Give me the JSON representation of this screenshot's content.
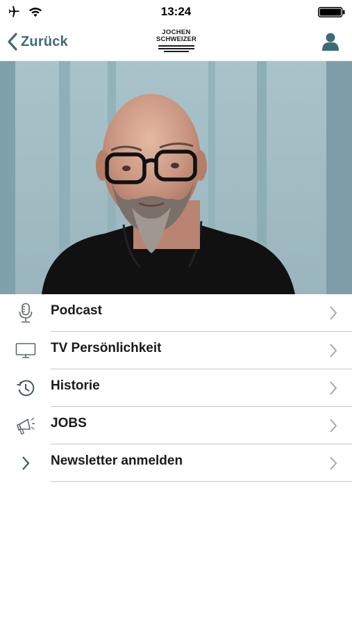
{
  "status_bar": {
    "time": "13:24"
  },
  "nav": {
    "back_label": "Zurück",
    "logo_line1": "JOCHEN",
    "logo_line2": "SCHWEIZER"
  },
  "menu": {
    "items": [
      {
        "label": "Podcast",
        "icon": "microphone-icon"
      },
      {
        "label": "TV Persönlichkeit",
        "icon": "tv-icon"
      },
      {
        "label": "Historie",
        "icon": "history-icon"
      },
      {
        "label": "JOBS",
        "icon": "megaphone-icon"
      },
      {
        "label": "Newsletter anmelden",
        "icon": "chevron-right-icon"
      }
    ]
  },
  "colors": {
    "accent": "#3e6b78",
    "divider": "#c8c8c8",
    "chevron": "#a8a8a8"
  }
}
